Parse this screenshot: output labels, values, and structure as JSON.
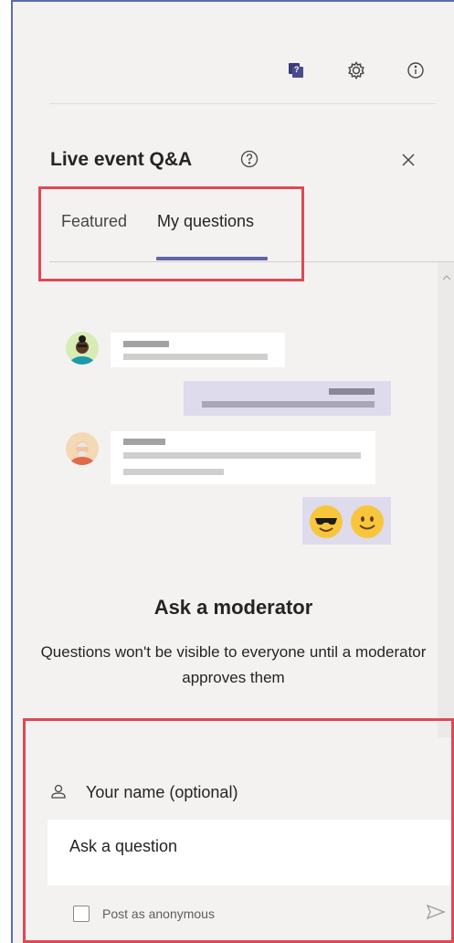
{
  "header": {
    "title": "Live event Q&A",
    "icons": [
      "qna-icon",
      "gear-icon",
      "info-icon",
      "help-icon",
      "close-icon"
    ]
  },
  "tabs": [
    {
      "label": "Featured",
      "selected": false
    },
    {
      "label": "My questions",
      "selected": true
    }
  ],
  "empty_state": {
    "heading": "Ask a moderator",
    "description": "Questions won't be visible to everyone until a moderator approves them"
  },
  "compose": {
    "name_label": "Your name (optional)",
    "question_placeholder": "Ask a question",
    "anonymous_label": "Post as anonymous",
    "anonymous_checked": false
  },
  "colors": {
    "accent": "#6264a7",
    "highlight": "#e04854",
    "panel_bg": "#f3f2f1"
  }
}
